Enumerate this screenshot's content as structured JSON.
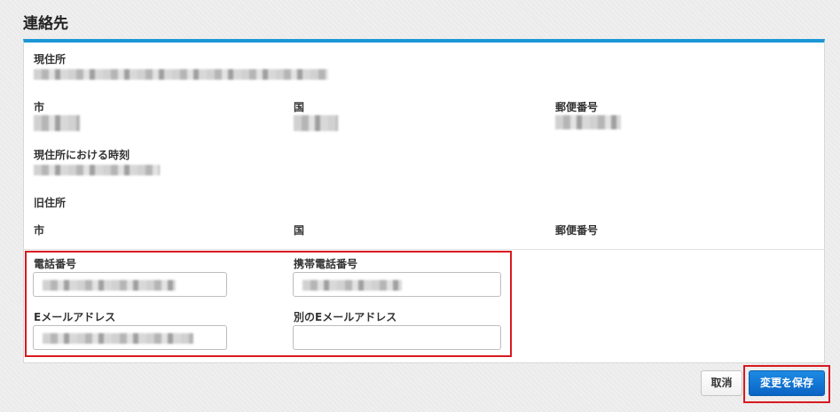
{
  "page_title": "連絡先",
  "address": {
    "current_label": "現住所",
    "city_label": "市",
    "country_label": "国",
    "postal_label": "郵便番号",
    "current_time_label": "現住所における時刻",
    "previous_label": "旧住所",
    "prev_city_label": "市",
    "prev_country_label": "国",
    "prev_postal_label": "郵便番号"
  },
  "form": {
    "phone_label": "電話番号",
    "mobile_label": "携帯電話番号",
    "email_label": "Eメールアドレス",
    "alt_email_label": "別のEメールアドレス",
    "alt_email_value": ""
  },
  "buttons": {
    "cancel": "取消",
    "save": "変更を保存"
  },
  "colors": {
    "accent_bar": "#1b97d6",
    "save_button": "#0b63c4",
    "highlight_border": "#d8191f"
  }
}
